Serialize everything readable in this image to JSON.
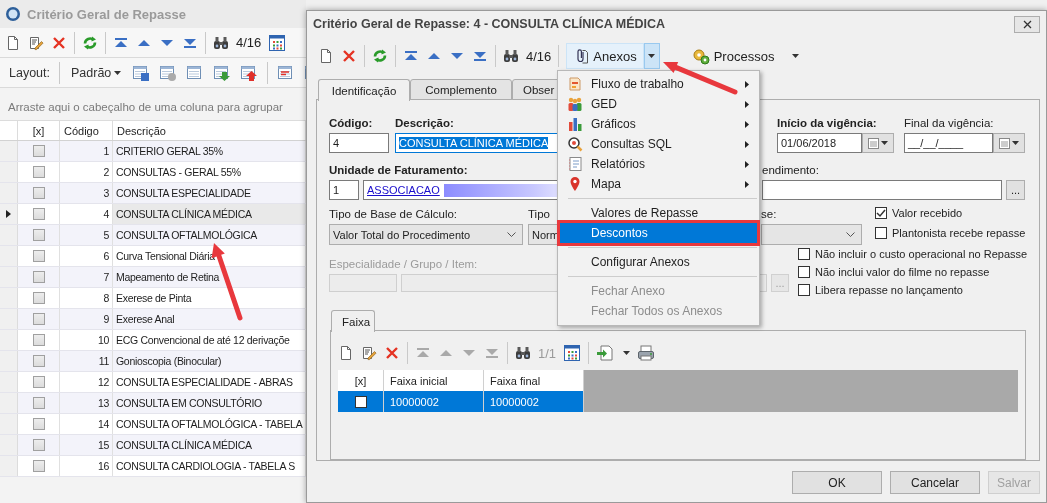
{
  "main_window": {
    "title": "Critério Geral de Repasse",
    "toolbar": {
      "counter": "4/16"
    },
    "layout_bar": {
      "label": "Layout:",
      "preset": "Padrão"
    },
    "group_panel": "Arraste aqui o cabeçalho de uma coluna para agrupar",
    "grid": {
      "columns": [
        "[x]",
        "Código",
        "Descrição"
      ],
      "rows": [
        {
          "checked": false,
          "selected": false,
          "code": "1",
          "description": "CRITERIO GERAL 35%"
        },
        {
          "checked": false,
          "selected": false,
          "code": "2",
          "description": "CONSULTAS - GERAL 55%"
        },
        {
          "checked": false,
          "selected": false,
          "code": "3",
          "description": "CONSULTA ESPECIALIDADE"
        },
        {
          "checked": false,
          "selected": true,
          "code": "4",
          "description": "CONSULTA CLÍNICA MÉDICA"
        },
        {
          "checked": false,
          "selected": false,
          "code": "5",
          "description": "CONSULTA OFTALMOLÓGICA"
        },
        {
          "checked": false,
          "selected": false,
          "code": "6",
          "description": "Curva Tensional Diária"
        },
        {
          "checked": false,
          "selected": false,
          "code": "7",
          "description": "Mapeamento de Retina"
        },
        {
          "checked": false,
          "selected": false,
          "code": "8",
          "description": "Exerese de Pinta"
        },
        {
          "checked": false,
          "selected": false,
          "code": "9",
          "description": "Exerese Anal"
        },
        {
          "checked": false,
          "selected": false,
          "code": "10",
          "description": "ECG Convencional de até 12 derivaçõe"
        },
        {
          "checked": false,
          "selected": false,
          "code": "11",
          "description": "Gonioscopia (Binocular)"
        },
        {
          "checked": false,
          "selected": false,
          "code": "12",
          "description": "CONSULTA ESPECIALIDADE - ABRAS"
        },
        {
          "checked": false,
          "selected": false,
          "code": "13",
          "description": "CONSULTA EM CONSULTÓRIO"
        },
        {
          "checked": false,
          "selected": false,
          "code": "14",
          "description": "CONSULTA OFTALMOLÓGICA - TABELA"
        },
        {
          "checked": false,
          "selected": false,
          "code": "15",
          "description": "CONSULTA CLÍNICA MÉDICA"
        },
        {
          "checked": false,
          "selected": false,
          "code": "16",
          "description": "CONSULTA CARDIOLOGIA - TABELA S"
        }
      ]
    }
  },
  "dialog": {
    "title": "Critério Geral de Repasse: 4 - CONSULTA CLÍNICA MÉDICA",
    "toolbar": {
      "counter": "4/16",
      "attachments": {
        "label": "Anexos",
        "open": true
      },
      "processes": {
        "label": "Processos"
      }
    },
    "tabs": [
      {
        "label": "Identificação",
        "selected": true
      },
      {
        "label": "Complemento",
        "selected": false
      },
      {
        "label": "Obser",
        "selected": false
      }
    ],
    "form": {
      "codigo": {
        "label": "Código:",
        "required": true,
        "value": "4"
      },
      "descricao": {
        "label": "Descrição:",
        "required": true,
        "value": "CONSULTA CLÍNICA MÉDICA"
      },
      "inicio_vigencia": {
        "label": "Início da vigência:",
        "required": true,
        "value": "01/06/2018"
      },
      "final_vigencia": {
        "label": "Final da vigência:",
        "required": false,
        "value": "__/__/____"
      },
      "unidade": {
        "label": "Unidade de Faturamento:",
        "required": true,
        "code": "1",
        "name": "ASSOCIACAO"
      },
      "field_2": {
        "label": "endimento:",
        "button": "..."
      },
      "tipo_base": {
        "label": "Tipo de Base de Cálculo:",
        "value": "Valor Total do Procedimento"
      },
      "tipo": {
        "label": "Tipo",
        "value": "Norm"
      },
      "field_3": {
        "label": "se:"
      },
      "especialidade": {
        "label": "Especialidade / Grupo / Item:",
        "disabled": true,
        "button": "..."
      },
      "checkboxes": [
        {
          "label": "Valor recebido",
          "checked": true
        },
        {
          "label": "Plantonista recebe repasse",
          "checked": false
        },
        {
          "label": "Não incluir o custo operacional no Repasse",
          "checked": false
        },
        {
          "label": "Não inclui valor do filme no repasse",
          "checked": false
        },
        {
          "label": "Libera repasse no lançamento",
          "checked": false
        }
      ]
    },
    "inner_tabs": [
      {
        "label": "Faixa",
        "selected": true
      }
    ],
    "faixa_toolbar": {
      "counter": "1/1",
      "navigation_disabled": true
    },
    "faixa_grid": {
      "columns": [
        "[x]",
        "Faixa inicial",
        "Faixa final"
      ],
      "rows": [
        {
          "checked": false,
          "selected": true,
          "faixa_inicial": "10000002",
          "faixa_final": "10000002"
        }
      ]
    },
    "buttons": [
      {
        "label": "OK",
        "disabled": false
      },
      {
        "label": "Cancelar",
        "disabled": false
      },
      {
        "label": "Salvar",
        "disabled": true
      }
    ]
  },
  "attachments_menu": {
    "items": [
      {
        "kind": "item",
        "label": "Fluxo de trabalho",
        "submenu": true,
        "disabled": false,
        "selected": false
      },
      {
        "kind": "item",
        "label": "GED",
        "submenu": true,
        "disabled": false,
        "selected": false
      },
      {
        "kind": "item",
        "label": "Gráficos",
        "submenu": true,
        "disabled": false,
        "selected": false
      },
      {
        "kind": "item",
        "label": "Consultas SQL",
        "submenu": true,
        "disabled": false,
        "selected": false
      },
      {
        "kind": "item",
        "label": "Relatórios",
        "submenu": true,
        "disabled": false,
        "selected": false
      },
      {
        "kind": "item",
        "label": "Mapa",
        "submenu": true,
        "disabled": false,
        "selected": false
      },
      {
        "kind": "separator"
      },
      {
        "kind": "item",
        "label": "Valores de Repasse",
        "submenu": false,
        "disabled": false,
        "selected": false
      },
      {
        "kind": "item",
        "label": "Descontos",
        "submenu": false,
        "disabled": false,
        "selected": true
      },
      {
        "kind": "separator"
      },
      {
        "kind": "item",
        "label": "Configurar Anexos",
        "submenu": false,
        "disabled": false,
        "selected": false
      },
      {
        "kind": "separator"
      },
      {
        "kind": "item",
        "label": "Fechar Anexo",
        "submenu": false,
        "disabled": true,
        "selected": false
      },
      {
        "kind": "item",
        "label": "Fechar Todos os Anexos",
        "submenu": false,
        "disabled": true,
        "selected": false
      }
    ]
  }
}
